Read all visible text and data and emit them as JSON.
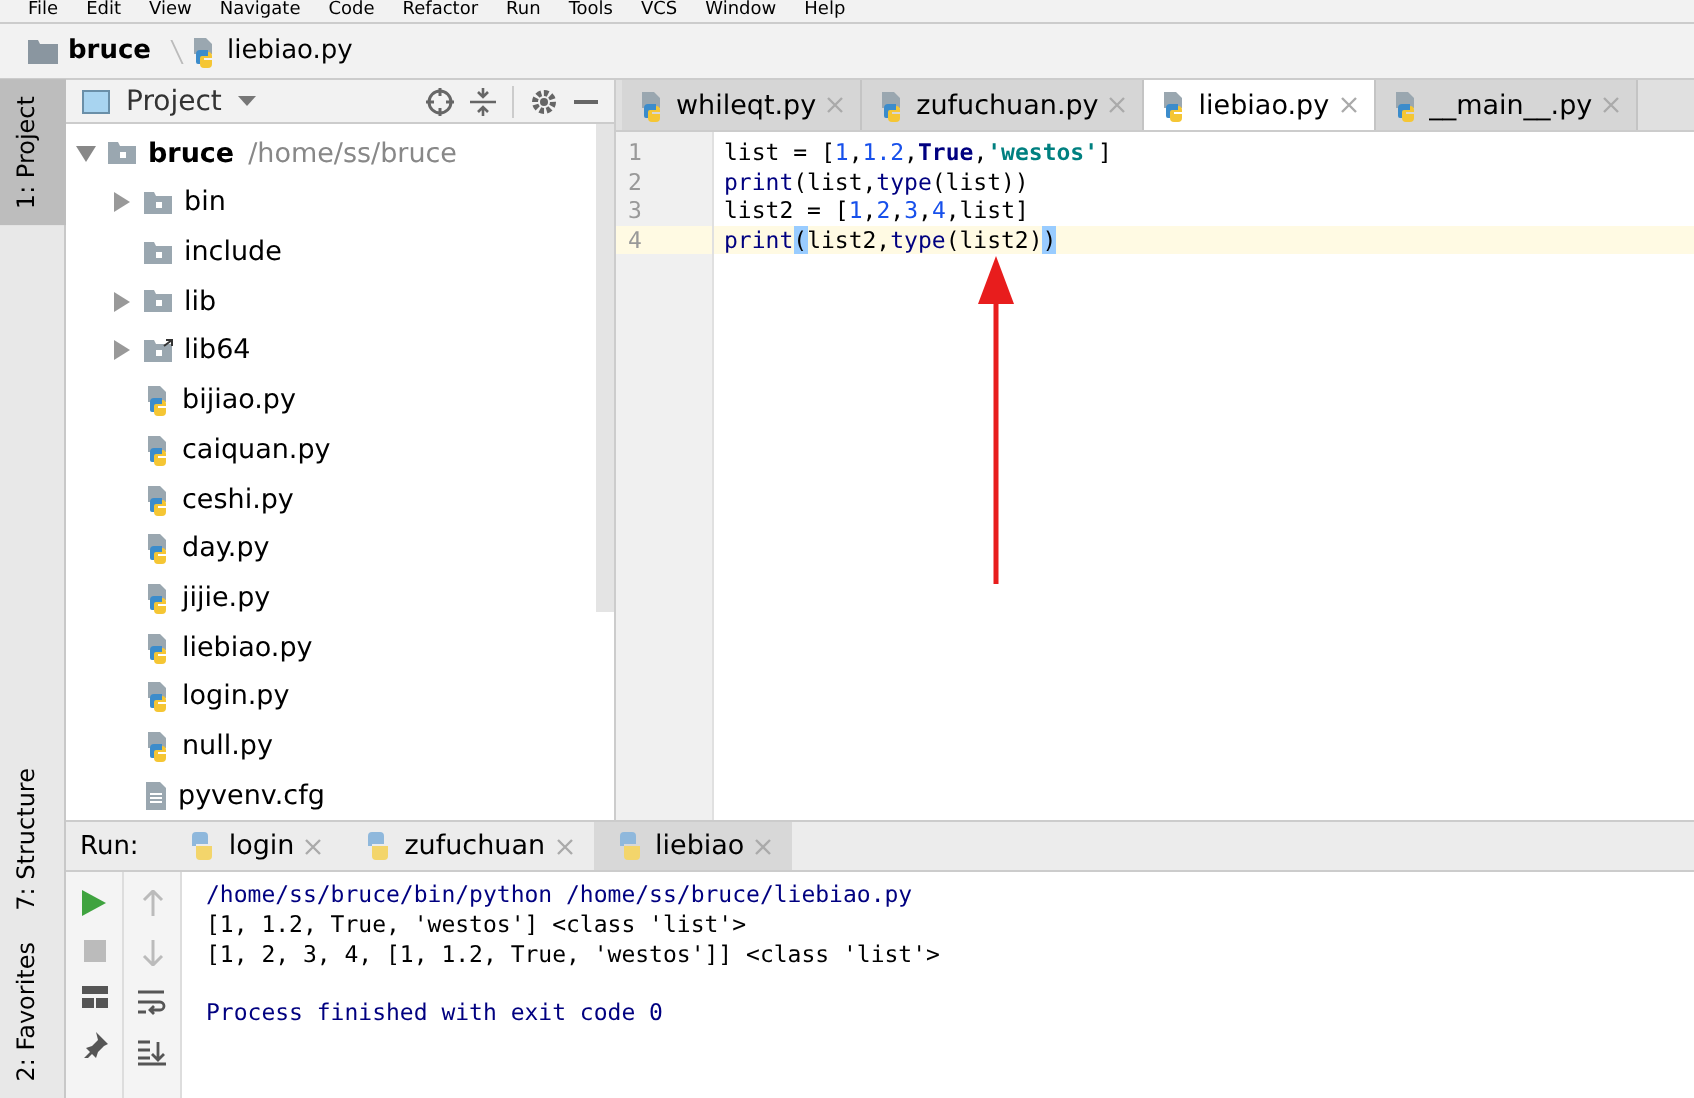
{
  "menu": [
    "File",
    "Edit",
    "View",
    "Navigate",
    "Code",
    "Refactor",
    "Run",
    "Tools",
    "VCS",
    "Window",
    "Help"
  ],
  "breadcrumb": [
    {
      "label": "bruce",
      "kind": "folder"
    },
    {
      "label": "liebiao.py",
      "kind": "python"
    }
  ],
  "side_tabs": [
    {
      "label": "1: Project",
      "selected": true
    },
    {
      "label": "7: Structure",
      "selected": false
    },
    {
      "label": "2: Favorites",
      "selected": false
    }
  ],
  "project": {
    "title": "Project",
    "tree": [
      {
        "label": "bruce",
        "path": "/home/ss/bruce",
        "kind": "folder",
        "expanded": true,
        "children": [
          {
            "label": "bin",
            "kind": "folder",
            "expanded": false
          },
          {
            "label": "include",
            "kind": "folder"
          },
          {
            "label": "lib",
            "kind": "folder",
            "expanded": false
          },
          {
            "label": "lib64",
            "kind": "folder-link",
            "expanded": false
          },
          {
            "label": "bijiao.py",
            "kind": "python"
          },
          {
            "label": "caiquan.py",
            "kind": "python"
          },
          {
            "label": "ceshi.py",
            "kind": "python"
          },
          {
            "label": "day.py",
            "kind": "python"
          },
          {
            "label": "jijie.py",
            "kind": "python"
          },
          {
            "label": "liebiao.py",
            "kind": "python"
          },
          {
            "label": "login.py",
            "kind": "python"
          },
          {
            "label": "null.py",
            "kind": "python"
          },
          {
            "label": "pyvenv.cfg",
            "kind": "text"
          }
        ]
      }
    ]
  },
  "editor_tabs": [
    {
      "label": "whileqt.py",
      "selected": false
    },
    {
      "label": "zufuchuan.py",
      "selected": false
    },
    {
      "label": "liebiao.py",
      "selected": true
    },
    {
      "label": "__main__.py",
      "selected": false
    }
  ],
  "code": [
    {
      "number": "1",
      "current": false,
      "tokens": [
        {
          "text": "list = [",
          "kind": "plain"
        },
        {
          "text": "1",
          "kind": "number"
        },
        {
          "text": ",",
          "kind": "plain"
        },
        {
          "text": "1.2",
          "kind": "number"
        },
        {
          "text": ",",
          "kind": "plain"
        },
        {
          "text": "True",
          "kind": "keyword"
        },
        {
          "text": ",",
          "kind": "plain"
        },
        {
          "text": "'westos'",
          "kind": "string"
        },
        {
          "text": "]",
          "kind": "plain"
        }
      ]
    },
    {
      "number": "2",
      "current": false,
      "tokens": [
        {
          "text": "print",
          "kind": "builtin"
        },
        {
          "text": "(list,",
          "kind": "plain"
        },
        {
          "text": "type",
          "kind": "builtin"
        },
        {
          "text": "(list))",
          "kind": "plain"
        }
      ]
    },
    {
      "number": "3",
      "current": false,
      "tokens": [
        {
          "text": "list2 = [",
          "kind": "plain"
        },
        {
          "text": "1",
          "kind": "number"
        },
        {
          "text": ",",
          "kind": "plain"
        },
        {
          "text": "2",
          "kind": "number"
        },
        {
          "text": ",",
          "kind": "plain"
        },
        {
          "text": "3",
          "kind": "number"
        },
        {
          "text": ",",
          "kind": "plain"
        },
        {
          "text": "4",
          "kind": "number"
        },
        {
          "text": ",list]",
          "kind": "plain"
        }
      ]
    },
    {
      "number": "4",
      "current": true,
      "tokens": [
        {
          "text": "print",
          "kind": "builtin"
        },
        {
          "text": "(",
          "kind": "matched"
        },
        {
          "text": "list2,",
          "kind": "plain"
        },
        {
          "text": "type",
          "kind": "builtin"
        },
        {
          "text": "(list2)",
          "kind": "plain"
        },
        {
          "text": ")",
          "kind": "matched"
        }
      ]
    }
  ],
  "run": {
    "label": "Run:",
    "tabs": [
      {
        "label": "login",
        "selected": false
      },
      {
        "label": "zufuchuan",
        "selected": false
      },
      {
        "label": "liebiao",
        "selected": true
      }
    ],
    "console": [
      {
        "text": "/home/ss/bruce/bin/python /home/ss/bruce/liebiao.py",
        "kind": "command"
      },
      {
        "text": "[1, 1.2, True, 'westos'] <class 'list'>",
        "kind": "output"
      },
      {
        "text": "[1, 2, 3, 4, [1, 1.2, True, 'westos']] <class 'list'>",
        "kind": "output"
      },
      {
        "text": "Process finished with exit code 0",
        "kind": "exit"
      }
    ]
  }
}
